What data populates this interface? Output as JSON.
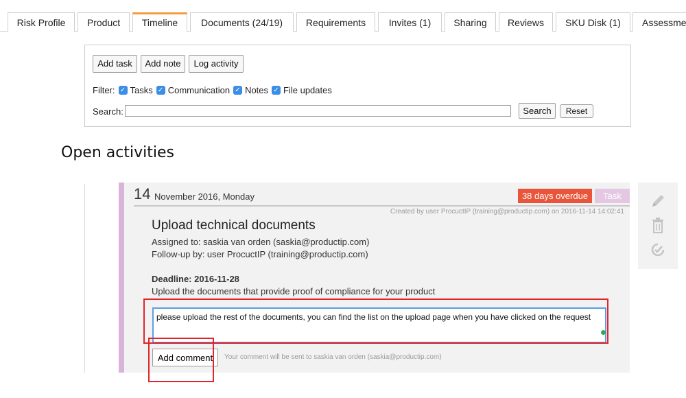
{
  "tabs": [
    {
      "label": "Risk Profile",
      "active": false
    },
    {
      "label": "Product",
      "active": false
    },
    {
      "label": "Timeline",
      "active": true
    },
    {
      "label": "Documents (24/19)",
      "active": false
    },
    {
      "label": "Requirements",
      "active": false
    },
    {
      "label": "Invites (1)",
      "active": false
    },
    {
      "label": "Sharing",
      "active": false
    },
    {
      "label": "Reviews",
      "active": false
    },
    {
      "label": "SKU Disk (1)",
      "active": false
    },
    {
      "label": "Assessment",
      "active": false
    }
  ],
  "toolbar": {
    "add_task": "Add task",
    "add_note": "Add note",
    "log_activity": "Log activity"
  },
  "filter": {
    "label": "Filter:",
    "options": [
      {
        "label": "Tasks",
        "checked": true
      },
      {
        "label": "Communication",
        "checked": true
      },
      {
        "label": "Notes",
        "checked": true
      },
      {
        "label": "File updates",
        "checked": true
      }
    ]
  },
  "search": {
    "label": "Search:",
    "value": "",
    "button": "Search",
    "reset": "Reset"
  },
  "section_title": "Open activities",
  "activity": {
    "day": "14",
    "date_rest": "November 2016, Monday",
    "overdue_badge": "38 days overdue",
    "type_badge": "Task",
    "created_by": "Created by user ProcuctIP (training@productip.com) on 2016-11-14 14:02:41",
    "title": "Upload technical documents",
    "assigned_to": "Assigned to: saskia van orden (saskia@productip.com)",
    "follow_up": "Follow-up by: user ProcuctIP (training@productip.com)",
    "deadline": "Deadline: 2016-11-28",
    "description": "Upload the documents that provide proof of compliance for your product",
    "comment_value": "please upload the rest of the documents, you can find the list on the upload page when you have clicked on the request",
    "add_comment": "Add comment",
    "comment_hint": "Your comment will be sent to saskia van orden (saskia@productip.com)"
  },
  "colors": {
    "tab_accent": "#f39c3c",
    "overdue": "#e8553a",
    "task_badge": "#e3c7e3",
    "card_border": "#d8b3da",
    "checkbox": "#3a8ee6",
    "highlight": "#e0262c"
  },
  "icons": {
    "edit": "pencil-icon",
    "delete": "trash-icon",
    "complete": "check-clock-icon"
  }
}
